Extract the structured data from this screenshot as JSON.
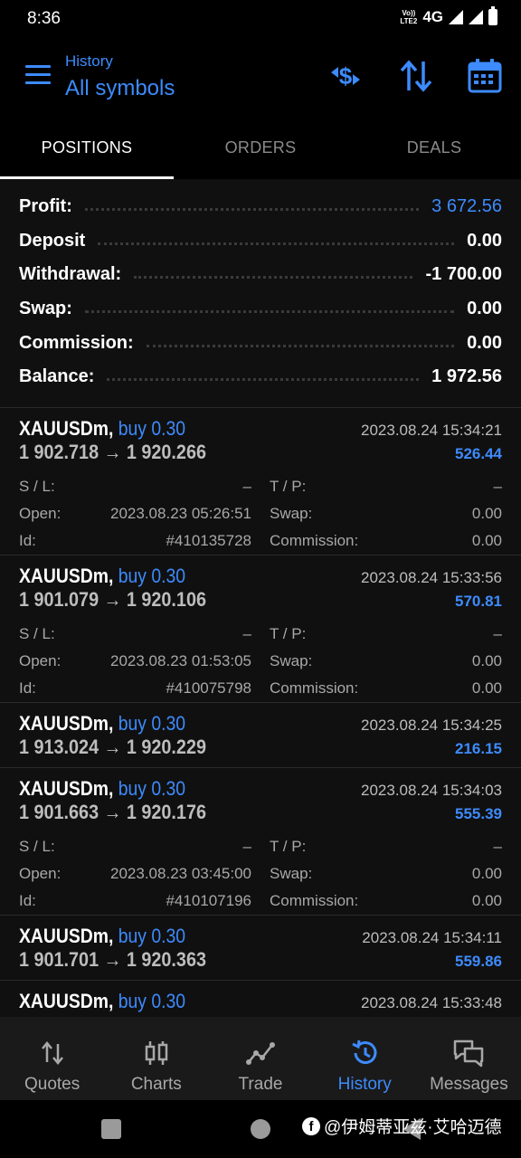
{
  "status_bar": {
    "time": "8:36",
    "network": "4G",
    "volte_top": "Vo))",
    "volte_bottom": "LTE2"
  },
  "toolbar": {
    "subtitle": "History",
    "title": "All symbols"
  },
  "tabs": [
    {
      "label": "POSITIONS",
      "active": true
    },
    {
      "label": "ORDERS",
      "active": false
    },
    {
      "label": "DEALS",
      "active": false
    }
  ],
  "summary": [
    {
      "label": "Profit:",
      "value": "3 672.56"
    },
    {
      "label": "Deposit",
      "value": "0.00"
    },
    {
      "label": "Withdrawal:",
      "value": "-1 700.00"
    },
    {
      "label": "Swap:",
      "value": "0.00"
    },
    {
      "label": "Commission:",
      "value": "0.00"
    },
    {
      "label": "Balance:",
      "value": "1 972.56"
    }
  ],
  "detail_labels": {
    "sl": "S / L:",
    "tp": "T / P:",
    "open": "Open:",
    "swap": "Swap:",
    "id": "Id:",
    "commission": "Commission:"
  },
  "positions": [
    {
      "symbol": "XAUUSDm,",
      "side": "buy 0.30",
      "time": "2023.08.24 15:34:21",
      "prices": "1 902.718 → 1 920.266",
      "profit": "526.44",
      "sl": "–",
      "tp": "–",
      "open": "2023.08.23 05:26:51",
      "swap": "0.00",
      "id": "#410135728",
      "commission": "0.00"
    },
    {
      "symbol": "XAUUSDm,",
      "side": "buy 0.30",
      "time": "2023.08.24 15:33:56",
      "prices": "1 901.079 → 1 920.106",
      "profit": "570.81",
      "sl": "–",
      "tp": "–",
      "open": "2023.08.23 01:53:05",
      "swap": "0.00",
      "id": "#410075798",
      "commission": "0.00"
    },
    {
      "symbol": "XAUUSDm,",
      "side": "buy 0.30",
      "time": "2023.08.24 15:34:25",
      "prices": "1 913.024 → 1 920.229",
      "profit": "216.15"
    },
    {
      "symbol": "XAUUSDm,",
      "side": "buy 0.30",
      "time": "2023.08.24 15:34:03",
      "prices": "1 901.663 → 1 920.176",
      "profit": "555.39",
      "sl": "–",
      "tp": "–",
      "open": "2023.08.23 03:45:00",
      "swap": "0.00",
      "id": "#410107196",
      "commission": "0.00"
    },
    {
      "symbol": "XAUUSDm,",
      "side": "buy 0.30",
      "time": "2023.08.24 15:34:11",
      "prices": "1 901.701 → 1 920.363",
      "profit": "559.86"
    },
    {
      "symbol": "XAUUSDm,",
      "side": "buy 0.30",
      "time": "2023.08.24 15:33:48",
      "prices": "",
      "profit": ""
    }
  ],
  "bottom_nav": [
    {
      "label": "Quotes",
      "icon": "quotes-icon",
      "active": false
    },
    {
      "label": "Charts",
      "icon": "charts-icon",
      "active": false
    },
    {
      "label": "Trade",
      "icon": "trade-icon",
      "active": false
    },
    {
      "label": "History",
      "icon": "history-icon",
      "active": true
    },
    {
      "label": "Messages",
      "icon": "messages-icon",
      "active": false
    }
  ],
  "watermark": {
    "text": "@伊姆蒂亚兹·艾哈迈德"
  },
  "colors": {
    "accent": "#3d8bfd",
    "background": "#000000",
    "panel": "#101010"
  }
}
